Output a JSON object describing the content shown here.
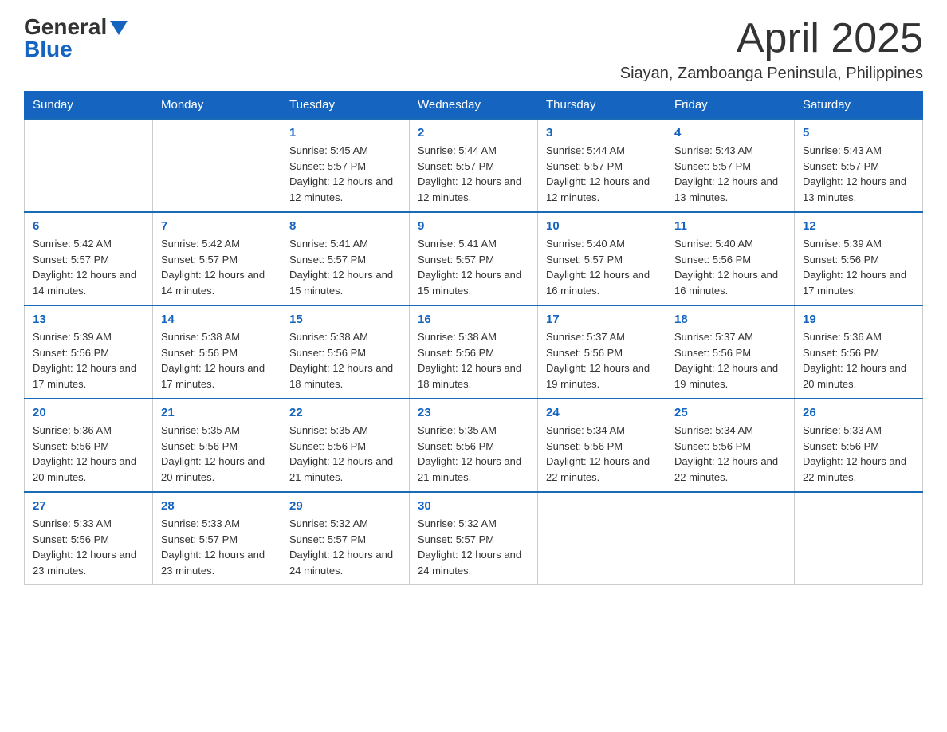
{
  "header": {
    "logo": {
      "general": "General",
      "triangle": "▶",
      "blue": "Blue"
    },
    "title": "April 2025",
    "location": "Siayan, Zamboanga Peninsula, Philippines"
  },
  "days_of_week": [
    "Sunday",
    "Monday",
    "Tuesday",
    "Wednesday",
    "Thursday",
    "Friday",
    "Saturday"
  ],
  "weeks": [
    [
      {
        "day": "",
        "info": ""
      },
      {
        "day": "",
        "info": ""
      },
      {
        "day": "1",
        "info": "Sunrise: 5:45 AM\nSunset: 5:57 PM\nDaylight: 12 hours\nand 12 minutes."
      },
      {
        "day": "2",
        "info": "Sunrise: 5:44 AM\nSunset: 5:57 PM\nDaylight: 12 hours\nand 12 minutes."
      },
      {
        "day": "3",
        "info": "Sunrise: 5:44 AM\nSunset: 5:57 PM\nDaylight: 12 hours\nand 12 minutes."
      },
      {
        "day": "4",
        "info": "Sunrise: 5:43 AM\nSunset: 5:57 PM\nDaylight: 12 hours\nand 13 minutes."
      },
      {
        "day": "5",
        "info": "Sunrise: 5:43 AM\nSunset: 5:57 PM\nDaylight: 12 hours\nand 13 minutes."
      }
    ],
    [
      {
        "day": "6",
        "info": "Sunrise: 5:42 AM\nSunset: 5:57 PM\nDaylight: 12 hours\nand 14 minutes."
      },
      {
        "day": "7",
        "info": "Sunrise: 5:42 AM\nSunset: 5:57 PM\nDaylight: 12 hours\nand 14 minutes."
      },
      {
        "day": "8",
        "info": "Sunrise: 5:41 AM\nSunset: 5:57 PM\nDaylight: 12 hours\nand 15 minutes."
      },
      {
        "day": "9",
        "info": "Sunrise: 5:41 AM\nSunset: 5:57 PM\nDaylight: 12 hours\nand 15 minutes."
      },
      {
        "day": "10",
        "info": "Sunrise: 5:40 AM\nSunset: 5:57 PM\nDaylight: 12 hours\nand 16 minutes."
      },
      {
        "day": "11",
        "info": "Sunrise: 5:40 AM\nSunset: 5:56 PM\nDaylight: 12 hours\nand 16 minutes."
      },
      {
        "day": "12",
        "info": "Sunrise: 5:39 AM\nSunset: 5:56 PM\nDaylight: 12 hours\nand 17 minutes."
      }
    ],
    [
      {
        "day": "13",
        "info": "Sunrise: 5:39 AM\nSunset: 5:56 PM\nDaylight: 12 hours\nand 17 minutes."
      },
      {
        "day": "14",
        "info": "Sunrise: 5:38 AM\nSunset: 5:56 PM\nDaylight: 12 hours\nand 17 minutes."
      },
      {
        "day": "15",
        "info": "Sunrise: 5:38 AM\nSunset: 5:56 PM\nDaylight: 12 hours\nand 18 minutes."
      },
      {
        "day": "16",
        "info": "Sunrise: 5:38 AM\nSunset: 5:56 PM\nDaylight: 12 hours\nand 18 minutes."
      },
      {
        "day": "17",
        "info": "Sunrise: 5:37 AM\nSunset: 5:56 PM\nDaylight: 12 hours\nand 19 minutes."
      },
      {
        "day": "18",
        "info": "Sunrise: 5:37 AM\nSunset: 5:56 PM\nDaylight: 12 hours\nand 19 minutes."
      },
      {
        "day": "19",
        "info": "Sunrise: 5:36 AM\nSunset: 5:56 PM\nDaylight: 12 hours\nand 20 minutes."
      }
    ],
    [
      {
        "day": "20",
        "info": "Sunrise: 5:36 AM\nSunset: 5:56 PM\nDaylight: 12 hours\nand 20 minutes."
      },
      {
        "day": "21",
        "info": "Sunrise: 5:35 AM\nSunset: 5:56 PM\nDaylight: 12 hours\nand 20 minutes."
      },
      {
        "day": "22",
        "info": "Sunrise: 5:35 AM\nSunset: 5:56 PM\nDaylight: 12 hours\nand 21 minutes."
      },
      {
        "day": "23",
        "info": "Sunrise: 5:35 AM\nSunset: 5:56 PM\nDaylight: 12 hours\nand 21 minutes."
      },
      {
        "day": "24",
        "info": "Sunrise: 5:34 AM\nSunset: 5:56 PM\nDaylight: 12 hours\nand 22 minutes."
      },
      {
        "day": "25",
        "info": "Sunrise: 5:34 AM\nSunset: 5:56 PM\nDaylight: 12 hours\nand 22 minutes."
      },
      {
        "day": "26",
        "info": "Sunrise: 5:33 AM\nSunset: 5:56 PM\nDaylight: 12 hours\nand 22 minutes."
      }
    ],
    [
      {
        "day": "27",
        "info": "Sunrise: 5:33 AM\nSunset: 5:56 PM\nDaylight: 12 hours\nand 23 minutes."
      },
      {
        "day": "28",
        "info": "Sunrise: 5:33 AM\nSunset: 5:57 PM\nDaylight: 12 hours\nand 23 minutes."
      },
      {
        "day": "29",
        "info": "Sunrise: 5:32 AM\nSunset: 5:57 PM\nDaylight: 12 hours\nand 24 minutes."
      },
      {
        "day": "30",
        "info": "Sunrise: 5:32 AM\nSunset: 5:57 PM\nDaylight: 12 hours\nand 24 minutes."
      },
      {
        "day": "",
        "info": ""
      },
      {
        "day": "",
        "info": ""
      },
      {
        "day": "",
        "info": ""
      }
    ]
  ]
}
